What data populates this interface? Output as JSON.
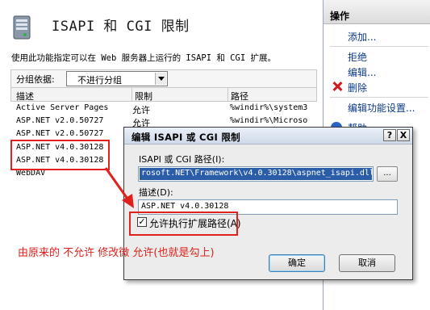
{
  "main": {
    "title": "ISAPI 和 CGI 限制",
    "description": "使用此功能指定可以在 Web 服务器上运行的 ISAPI 和 CGI 扩展。",
    "group_by_label": "分组依据:",
    "group_by_value": "不进行分组",
    "columns": [
      "描述",
      "限制",
      "路径"
    ],
    "rows": [
      {
        "desc": "Active Server Pages",
        "restriction": "允许",
        "path": "%windir%\\system3"
      },
      {
        "desc": "ASP.NET v2.0.50727",
        "restriction": "允许",
        "path": "%windir%\\Microso"
      },
      {
        "desc": "ASP.NET v2.0.50727",
        "restriction": "",
        "path": ""
      },
      {
        "desc": "ASP.NET v4.0.30128",
        "restriction": "",
        "path": ""
      },
      {
        "desc": "ASP.NET v4.0.30128",
        "restriction": "",
        "path": ""
      },
      {
        "desc": "WebDAV",
        "restriction": "",
        "path": ""
      }
    ]
  },
  "actions": {
    "title": "操作",
    "items": [
      "添加...",
      "拒绝",
      "编辑...",
      "删除",
      "编辑功能设置...",
      "帮助"
    ]
  },
  "dialog": {
    "title": "编辑 ISAPI 或 CGI 限制",
    "help_button": "?",
    "close_button": "X",
    "path_label": "ISAPI 或 CGI 路径(I):",
    "path_value": "rosoft.NET\\Framework\\v4.0.30128\\aspnet_isapi.dll",
    "browse_label": "...",
    "desc_label": "描述(D):",
    "desc_value": "ASP.NET v4.0.30128",
    "checkbox_checked": true,
    "checkbox_mark": "✓",
    "checkbox_label": "允许执行扩展路径(A)",
    "ok_label": "确定",
    "cancel_label": "取消"
  },
  "annotation": {
    "note": "由原来的 不允许 修改微 允许(也就是勾上)",
    "color": "#e0211d"
  },
  "colors": {
    "selection": "#2b5ca8",
    "link": "#0b3a8a",
    "delete": "#d11a1a"
  }
}
